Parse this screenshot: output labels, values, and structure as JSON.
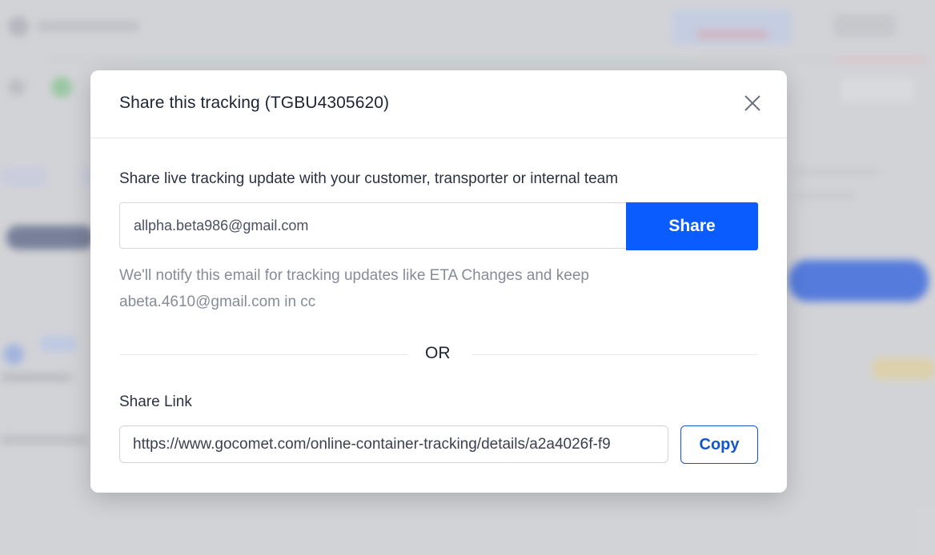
{
  "modal": {
    "title": "Share this tracking (TGBU4305620)",
    "close_icon": "close-icon",
    "share_description": "Share live tracking update with your customer, transporter or internal team",
    "email_input_value": "allpha.beta986@gmail.com",
    "share_button_label": "Share",
    "notify_text": "We'll notify this email for tracking updates like ETA Changes and keep abeta.4610@gmail.com in cc",
    "or_label": "OR",
    "share_link_label": "Share Link",
    "share_link_value": "https://www.gocomet.com/online-container-tracking/details/a2a4026f-f9",
    "copy_button_label": "Copy"
  },
  "colors": {
    "primary": "#0a5cff",
    "copy_border": "#1554c9",
    "muted_text": "#868c96"
  }
}
